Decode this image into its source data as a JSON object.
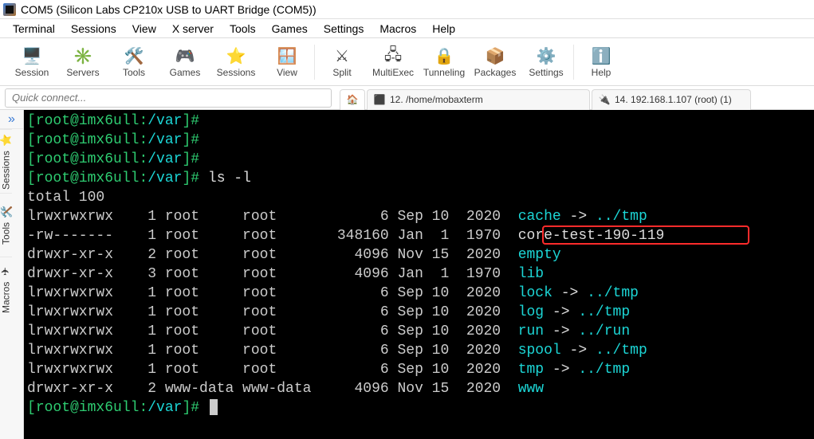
{
  "window": {
    "title": "COM5  (Silicon Labs CP210x USB to UART Bridge (COM5))"
  },
  "menu": {
    "items": [
      "Terminal",
      "Sessions",
      "View",
      "X server",
      "Tools",
      "Games",
      "Settings",
      "Macros",
      "Help"
    ]
  },
  "toolbar": {
    "items": [
      {
        "label": "Session",
        "icon": "🖥️"
      },
      {
        "label": "Servers",
        "icon": "✳️"
      },
      {
        "label": "Tools",
        "icon": "🛠️"
      },
      {
        "label": "Games",
        "icon": "🎮"
      },
      {
        "label": "Sessions",
        "icon": "⭐"
      },
      {
        "label": "View",
        "icon": "🪟"
      },
      {
        "label": "Split",
        "icon": "⚔"
      },
      {
        "label": "MultiExec",
        "icon": "🖧"
      },
      {
        "label": "Tunneling",
        "icon": "🔒"
      },
      {
        "label": "Packages",
        "icon": "📦"
      },
      {
        "label": "Settings",
        "icon": "⚙️"
      },
      {
        "label": "Help",
        "icon": "ℹ️"
      }
    ]
  },
  "quick": {
    "placeholder": "Quick connect..."
  },
  "tabs": {
    "home_icon": "🏠",
    "t1": {
      "icon": "⬛",
      "label": "12. /home/mobaxterm"
    },
    "t2": {
      "icon": "🔌",
      "label": "14. 192.168.1.107 (root) (1)"
    }
  },
  "sidebar": {
    "expand": "»",
    "tabs": [
      {
        "label": "Sessions",
        "icon": "⭐"
      },
      {
        "label": "Tools",
        "icon": "🛠️"
      },
      {
        "label": "Macros",
        "icon": "✈"
      }
    ]
  },
  "terminal": {
    "prompt_user": "root",
    "prompt_host": "imx6ull",
    "prompt_path": "/var",
    "command": "ls -l",
    "total": "total 100",
    "rows": [
      {
        "perm": "lrwxrwxrwx",
        "links": "1",
        "owner": "root",
        "group": "root",
        "size": "6",
        "date": "Sep 10",
        "year": "2020",
        "name": "cache",
        "arrow": " -> ",
        "target": "../tmp",
        "name_color": "c",
        "target_color": "c"
      },
      {
        "perm": "-rw-------",
        "links": "1",
        "owner": "root",
        "group": "root",
        "size": "348160",
        "date": "Jan  1",
        "year": "1970",
        "name": "core-test-190-119",
        "arrow": "",
        "target": "",
        "name_color": "w",
        "target_color": "",
        "highlight": true
      },
      {
        "perm": "drwxr-xr-x",
        "links": "2",
        "owner": "root",
        "group": "root",
        "size": "4096",
        "date": "Nov 15",
        "year": "2020",
        "name": "empty",
        "arrow": "",
        "target": "",
        "name_color": "c",
        "target_color": ""
      },
      {
        "perm": "drwxr-xr-x",
        "links": "3",
        "owner": "root",
        "group": "root",
        "size": "4096",
        "date": "Jan  1",
        "year": "1970",
        "name": "lib",
        "arrow": "",
        "target": "",
        "name_color": "c",
        "target_color": ""
      },
      {
        "perm": "lrwxrwxrwx",
        "links": "1",
        "owner": "root",
        "group": "root",
        "size": "6",
        "date": "Sep 10",
        "year": "2020",
        "name": "lock",
        "arrow": " -> ",
        "target": "../tmp",
        "name_color": "c",
        "target_color": "c"
      },
      {
        "perm": "lrwxrwxrwx",
        "links": "1",
        "owner": "root",
        "group": "root",
        "size": "6",
        "date": "Sep 10",
        "year": "2020",
        "name": "log",
        "arrow": " -> ",
        "target": "../tmp",
        "name_color": "c",
        "target_color": "c"
      },
      {
        "perm": "lrwxrwxrwx",
        "links": "1",
        "owner": "root",
        "group": "root",
        "size": "6",
        "date": "Sep 10",
        "year": "2020",
        "name": "run",
        "arrow": " -> ",
        "target": "../run",
        "name_color": "c",
        "target_color": "c"
      },
      {
        "perm": "lrwxrwxrwx",
        "links": "1",
        "owner": "root",
        "group": "root",
        "size": "6",
        "date": "Sep 10",
        "year": "2020",
        "name": "spool",
        "arrow": " -> ",
        "target": "../tmp",
        "name_color": "c",
        "target_color": "c"
      },
      {
        "perm": "lrwxrwxrwx",
        "links": "1",
        "owner": "root",
        "group": "root",
        "size": "6",
        "date": "Sep 10",
        "year": "2020",
        "name": "tmp",
        "arrow": " -> ",
        "target": "../tmp",
        "name_color": "c",
        "target_color": "c"
      },
      {
        "perm": "drwxr-xr-x",
        "links": "2",
        "owner": "www-data",
        "group": "www-data",
        "size": "4096",
        "date": "Nov 15",
        "year": "2020",
        "name": "www",
        "arrow": "",
        "target": "",
        "name_color": "c",
        "target_color": ""
      }
    ]
  }
}
